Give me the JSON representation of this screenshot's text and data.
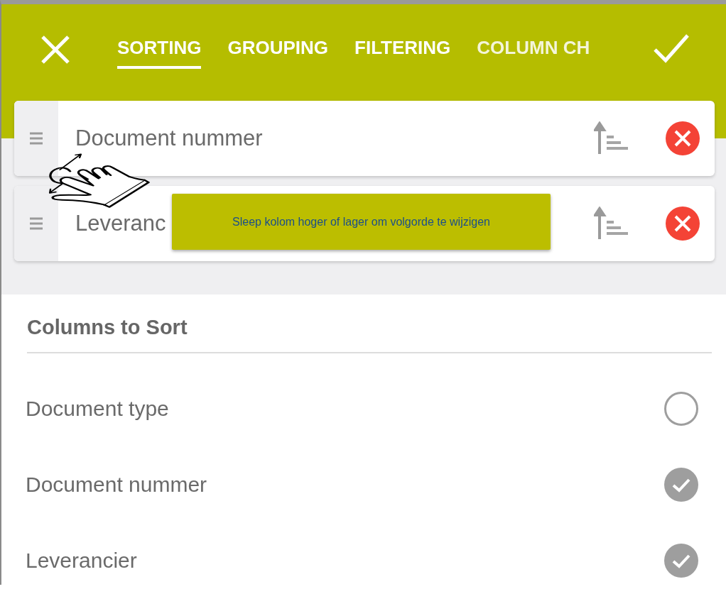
{
  "tabs": [
    {
      "label": "SORTING",
      "selected": true
    },
    {
      "label": "GROUPING",
      "selected": false
    },
    {
      "label": "FILTERING",
      "selected": false
    },
    {
      "label": "COLUMN CH",
      "selected": false
    }
  ],
  "sort_columns": [
    {
      "name": "Document nummer"
    },
    {
      "name": "Leveranc"
    }
  ],
  "tooltip": "Sleep kolom hoger of lager om volgorde te wijzigen",
  "section_title": "Columns to Sort",
  "columns": [
    {
      "name": "Document type",
      "checked": false
    },
    {
      "name": "Document nummer",
      "checked": true
    },
    {
      "name": "Leverancier",
      "checked": true
    }
  ]
}
